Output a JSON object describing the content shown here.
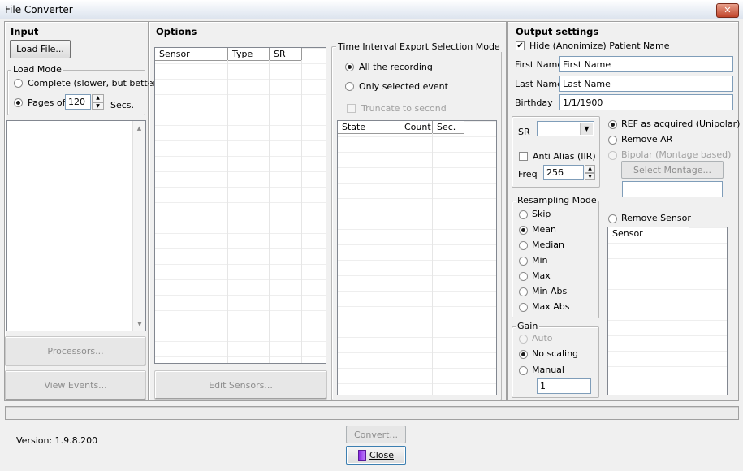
{
  "window": {
    "title": "File Converter",
    "close_label": "✕"
  },
  "input": {
    "header": "Input",
    "load_file_label": "Load File...",
    "load_mode_label": "Load Mode",
    "complete_label": "Complete (slower, but better)",
    "pages_of_label": "Pages of",
    "pages_value": "120",
    "secs_label": "Secs.",
    "processors_label": "Processors...",
    "view_events_label": "View Events..."
  },
  "options": {
    "header": "Options",
    "sensor_columns": [
      "Sensor",
      "Type",
      "SR"
    ],
    "edit_sensors_label": "Edit Sensors...",
    "time_interval_label": "Time Interval Export Selection Mode",
    "all_recording_label": "All the recording",
    "only_selected_label": "Only selected event",
    "truncate_label": "Truncate to second",
    "state_columns": [
      "State",
      "Count",
      "Sec."
    ]
  },
  "output": {
    "header": "Output settings",
    "hide_patient_label": "Hide (Anonimize) Patient Name",
    "first_name_label": "First Name",
    "first_name_value": "First Name",
    "last_name_label": "Last Name",
    "last_name_value": "Last Name",
    "birthday_label": "Birthday",
    "birthday_value": "1/1/1900",
    "sr_label": "SR",
    "anti_alias_label": "Anti Alias (IIR)",
    "freq_label": "Freq",
    "freq_value": "256",
    "ref_label": "REF as acquired (Unipolar)",
    "remove_ar_label": "Remove AR",
    "bipolar_label": "Bipolar (Montage based)",
    "select_montage_label": "Select Montage...",
    "remove_sensor_label": "Remove Sensor",
    "sensor_column": "Sensor",
    "resampling_label": "Resampling Mode",
    "resampling_options": [
      "Skip",
      "Mean",
      "Median",
      "Min",
      "Max",
      "Min Abs",
      "Max Abs"
    ],
    "gain_label": "Gain",
    "gain_auto_label": "Auto",
    "gain_no_scaling_label": "No scaling",
    "gain_manual_label": "Manual",
    "gain_manual_value": "1"
  },
  "footer": {
    "version_label": "Version: 1.9.8.200",
    "convert_label": "Convert...",
    "close_label": "Close"
  }
}
